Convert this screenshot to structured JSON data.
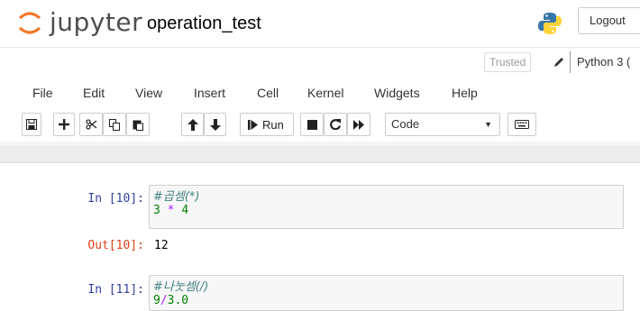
{
  "header": {
    "logo_text": "jupyter",
    "notebook_name": "operation_test",
    "logout_label": "Logout"
  },
  "status": {
    "trusted_label": "Trusted",
    "kernel_name": "Python 3 ("
  },
  "menu": [
    "File",
    "Edit",
    "View",
    "Insert",
    "Cell",
    "Kernel",
    "Widgets",
    "Help"
  ],
  "toolbar": {
    "run_label": "Run",
    "cell_type": "Code"
  },
  "cells": [
    {
      "in_prompt": "In [10]:",
      "comment": "#곱셈(*)",
      "code": {
        "a": "3",
        "op": "*",
        "b": "4"
      },
      "out_prompt": "Out[10]:",
      "output": "12"
    },
    {
      "in_prompt": "In [11]:",
      "comment": "#나눗셈(/)",
      "code": {
        "a": "9",
        "op": "/",
        "b": "3.0"
      }
    }
  ]
}
